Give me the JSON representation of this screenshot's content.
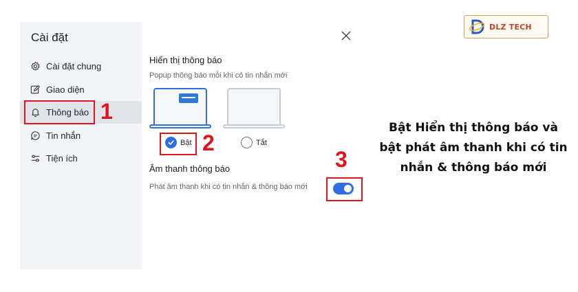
{
  "sidebar": {
    "title": "Cài đặt",
    "items": [
      {
        "label": "Cài đặt chung",
        "icon": "gear-icon"
      },
      {
        "label": "Giao diện",
        "icon": "edit-square-icon"
      },
      {
        "label": "Thông báo",
        "icon": "bell-icon",
        "active": true
      },
      {
        "label": "Tin nhắn",
        "icon": "chat-bubble-icon"
      },
      {
        "label": "Tiện ích",
        "icon": "sliders-icon"
      }
    ]
  },
  "notifications": {
    "display_title": "Hiển thị thông báo",
    "display_subtitle": "Popup thông báo mỗi khi có tin nhắn mới",
    "option_on": "Bật",
    "option_off": "Tắt",
    "selected_option": "Bật",
    "sound_title": "Âm thanh thông báo",
    "sound_label": "Phát âm thanh khi có tin nhắn & thông báo mới",
    "sound_enabled": true
  },
  "steps": [
    "1",
    "2",
    "3"
  ],
  "logo": {
    "text": "DLZ TECH"
  },
  "caption": {
    "line1": "Bật Hiển thị thông báo và",
    "line2": "bật phát âm thanh khi có tin",
    "line3": "nhắn & thông báo mới"
  },
  "colors": {
    "accent": "#2f6fe0",
    "highlight_red": "#e0141e",
    "sidebar_bg": "#f2f4f7",
    "active_item_bg": "#e1e5ea"
  }
}
